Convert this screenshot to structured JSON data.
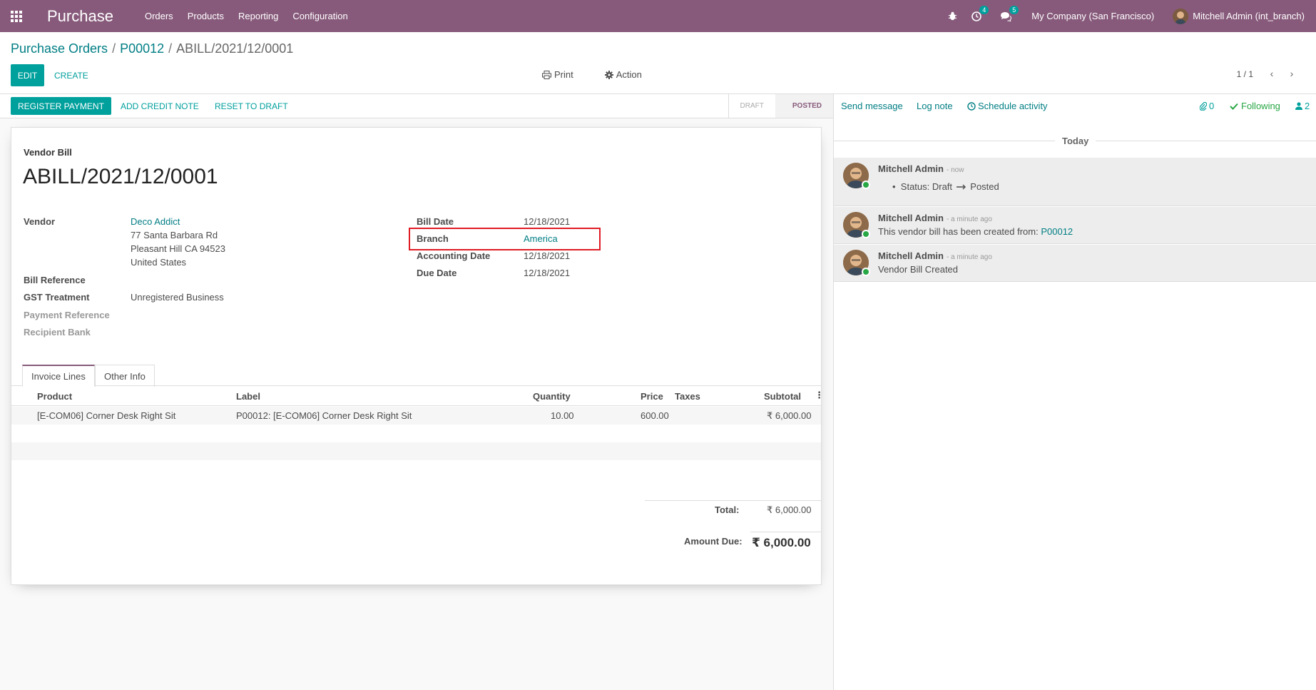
{
  "navbar": {
    "app_name": "Purchase",
    "menu": [
      "Orders",
      "Products",
      "Reporting",
      "Configuration"
    ],
    "activity_count": "4",
    "message_count": "5",
    "company": "My Company (San Francisco)",
    "user": "Mitchell Admin (int_branch)"
  },
  "breadcrumb": {
    "item1": "Purchase Orders",
    "item2": "P00012",
    "current": "ABILL/2021/12/0001"
  },
  "control": {
    "edit": "EDIT",
    "create": "CREATE",
    "print": "Print",
    "action": "Action",
    "pager": "1 / 1"
  },
  "statusbar": {
    "register_payment": "REGISTER PAYMENT",
    "add_credit_note": "ADD CREDIT NOTE",
    "reset_to_draft": "RESET TO DRAFT",
    "stage_draft": "DRAFT",
    "stage_posted": "POSTED"
  },
  "form": {
    "doc_type": "Vendor Bill",
    "doc_name": "ABILL/2021/12/0001",
    "vendor_label": "Vendor",
    "vendor_name": "Deco Addict",
    "vendor_addr1": "77 Santa Barbara Rd",
    "vendor_addr2": "Pleasant Hill CA 94523",
    "vendor_addr3": "United States",
    "bill_reference_label": "Bill Reference",
    "gst_label": "GST Treatment",
    "gst_value": "Unregistered Business",
    "payment_reference_label": "Payment Reference",
    "recipient_bank_label": "Recipient Bank",
    "bill_date_label": "Bill Date",
    "bill_date": "12/18/2021",
    "branch_label": "Branch",
    "branch": "America",
    "accounting_date_label": "Accounting Date",
    "accounting_date": "12/18/2021",
    "due_date_label": "Due Date",
    "due_date": "12/18/2021"
  },
  "tabs": {
    "invoice_lines": "Invoice Lines",
    "other_info": "Other Info"
  },
  "table": {
    "headers": {
      "product": "Product",
      "label": "Label",
      "quantity": "Quantity",
      "price": "Price",
      "taxes": "Taxes",
      "subtotal": "Subtotal"
    },
    "rows": [
      {
        "product": "[E-COM06] Corner Desk Right Sit",
        "label": "P00012: [E-COM06] Corner Desk Right Sit",
        "quantity": "10.00",
        "price": "600.00",
        "taxes": "",
        "subtotal": "₹ 6,000.00"
      }
    ]
  },
  "totals": {
    "total_label": "Total:",
    "total": "₹ 6,000.00",
    "amount_due_label": "Amount Due:",
    "amount_due": "₹ 6,000.00"
  },
  "chatter": {
    "send_message": "Send message",
    "log_note": "Log note",
    "schedule_activity": "Schedule activity",
    "attachments": "0",
    "following": "Following",
    "followers": "2",
    "today": "Today",
    "messages": [
      {
        "author": "Mitchell Admin",
        "time": "- now",
        "body_prefix": "Status: Draft",
        "body_suffix": "Posted"
      },
      {
        "author": "Mitchell Admin",
        "time": "- a minute ago",
        "body": "This vendor bill has been created from: ",
        "link": "P00012"
      },
      {
        "author": "Mitchell Admin",
        "time": "- a minute ago",
        "body": "Vendor Bill Created"
      }
    ]
  },
  "colors": {
    "brand": "#875a7b",
    "accent": "#00a09d",
    "link": "#017e84",
    "highlight_box": "#e01b24"
  }
}
